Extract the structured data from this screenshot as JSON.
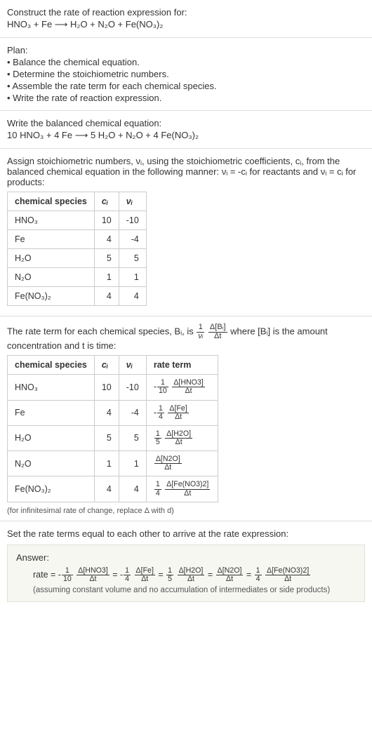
{
  "prompt": {
    "line1": "Construct the rate of reaction expression for:",
    "equation": "HNO₃ + Fe ⟶ H₂O + N₂O + Fe(NO₃)₂"
  },
  "plan": {
    "title": "Plan:",
    "b1": "• Balance the chemical equation.",
    "b2": "• Determine the stoichiometric numbers.",
    "b3": "• Assemble the rate term for each chemical species.",
    "b4": "• Write the rate of reaction expression."
  },
  "balanced": {
    "title": "Write the balanced chemical equation:",
    "equation": "10 HNO₃ + 4 Fe ⟶ 5 H₂O + N₂O + 4 Fe(NO₃)₂"
  },
  "stoich": {
    "intro1": "Assign stoichiometric numbers, νᵢ, using the stoichiometric coefficients, cᵢ, from the balanced chemical equation in the following manner: νᵢ = -cᵢ for reactants and νᵢ = cᵢ for products:",
    "headers": {
      "h1": "chemical species",
      "h2": "cᵢ",
      "h3": "νᵢ"
    },
    "rows": [
      {
        "species": "HNO₃",
        "c": "10",
        "v": "-10"
      },
      {
        "species": "Fe",
        "c": "4",
        "v": "-4"
      },
      {
        "species": "H₂O",
        "c": "5",
        "v": "5"
      },
      {
        "species": "N₂O",
        "c": "1",
        "v": "1"
      },
      {
        "species": "Fe(NO₃)₂",
        "c": "4",
        "v": "4"
      }
    ]
  },
  "rateterm": {
    "intro_pre": "The rate term for each chemical species, Bᵢ, is ",
    "intro_post": " where [Bᵢ] is the amount concentration and t is time:",
    "frac_outer_num": "1",
    "frac_outer_den": "νᵢ",
    "frac_inner_num": "Δ[Bᵢ]",
    "frac_inner_den": "Δt",
    "headers": {
      "h1": "chemical species",
      "h2": "cᵢ",
      "h3": "νᵢ",
      "h4": "rate term"
    },
    "rows": [
      {
        "species": "HNO₃",
        "c": "10",
        "v": "-10",
        "sign": "-",
        "cn": "1",
        "cd": "10",
        "dn": "Δ[HNO3]",
        "dd": "Δt"
      },
      {
        "species": "Fe",
        "c": "4",
        "v": "-4",
        "sign": "-",
        "cn": "1",
        "cd": "4",
        "dn": "Δ[Fe]",
        "dd": "Δt"
      },
      {
        "species": "H₂O",
        "c": "5",
        "v": "5",
        "sign": "",
        "cn": "1",
        "cd": "5",
        "dn": "Δ[H2O]",
        "dd": "Δt"
      },
      {
        "species": "N₂O",
        "c": "1",
        "v": "1",
        "sign": "",
        "cn": "",
        "cd": "",
        "dn": "Δ[N2O]",
        "dd": "Δt"
      },
      {
        "species": "Fe(NO₃)₂",
        "c": "4",
        "v": "4",
        "sign": "",
        "cn": "1",
        "cd": "4",
        "dn": "Δ[Fe(NO3)2]",
        "dd": "Δt"
      }
    ],
    "note": "(for infinitesimal rate of change, replace Δ with d)"
  },
  "final": {
    "title": "Set the rate terms equal to each other to arrive at the rate expression:",
    "answer_label": "Answer:",
    "rate_label": "rate = ",
    "terms": [
      {
        "sign": "-",
        "cn": "1",
        "cd": "10",
        "dn": "Δ[HNO3]",
        "dd": "Δt"
      },
      {
        "sign": "-",
        "cn": "1",
        "cd": "4",
        "dn": "Δ[Fe]",
        "dd": "Δt"
      },
      {
        "sign": "",
        "cn": "1",
        "cd": "5",
        "dn": "Δ[H2O]",
        "dd": "Δt"
      },
      {
        "sign": "",
        "cn": "",
        "cd": "",
        "dn": "Δ[N2O]",
        "dd": "Δt"
      },
      {
        "sign": "",
        "cn": "1",
        "cd": "4",
        "dn": "Δ[Fe(NO3)2]",
        "dd": "Δt"
      }
    ],
    "eq": " = ",
    "note": "(assuming constant volume and no accumulation of intermediates or side products)"
  }
}
